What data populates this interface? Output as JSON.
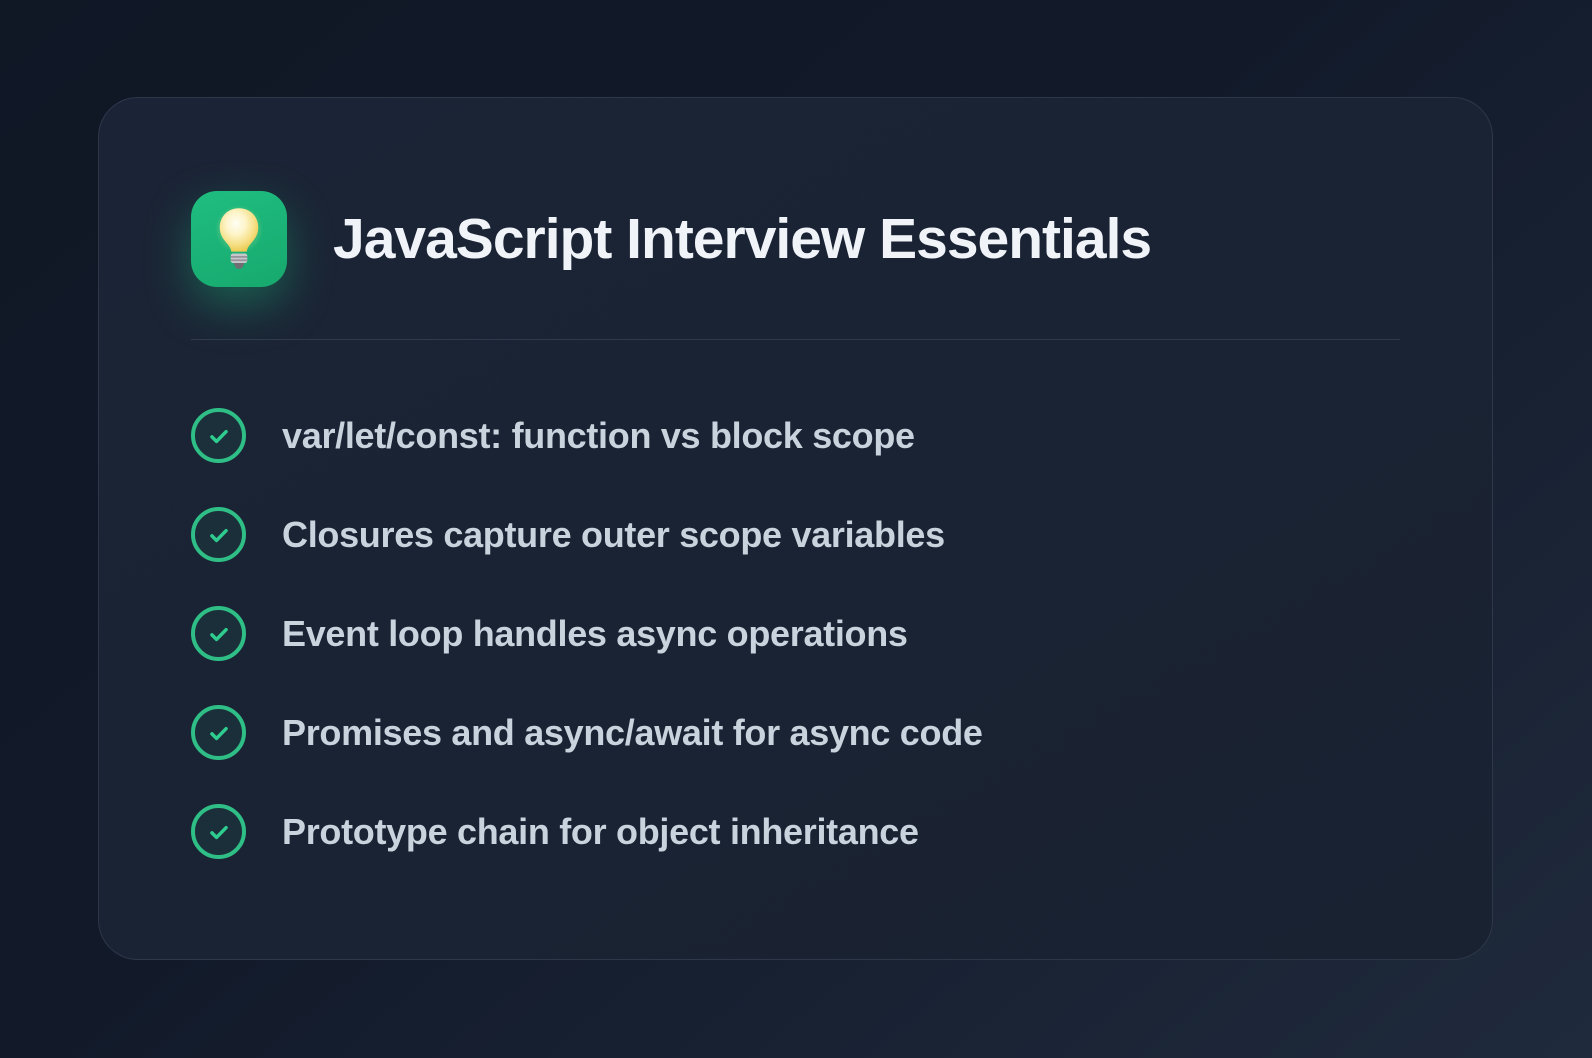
{
  "card": {
    "title": "JavaScript Interview Essentials",
    "icon": {
      "name": "lightbulb-icon"
    },
    "items": [
      "var/let/const: function vs block scope",
      "Closures capture outer scope variables",
      "Event loop handles async operations",
      "Promises and async/await for async code",
      "Prototype chain for object inheritance"
    ],
    "colors": {
      "accent_green": "#1cb377",
      "check_green": "#2ebe86",
      "title_text": "#f0f4f8",
      "item_text": "#c9d3de",
      "card_background": "#1a2333",
      "page_background": "#121a2a"
    }
  }
}
